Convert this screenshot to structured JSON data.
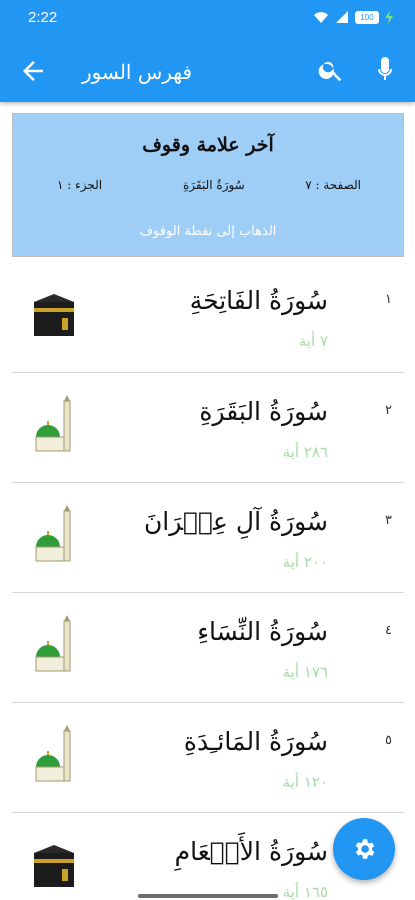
{
  "status_bar": {
    "time": "2:22",
    "battery": "100"
  },
  "header": {
    "title": "فهرس السور"
  },
  "bookmark": {
    "title": "آخر علامة وقوف",
    "page_label": "الصفحة : ٧",
    "sura_label": "سُورَةُ البَقَرَةِ",
    "juz_label": "الجزء : ١",
    "goto_label": "الذهاب إلى نقطة الوقوف"
  },
  "suras": [
    {
      "number": "١",
      "name": "سُورَةُ الفَاتِحَةِ",
      "ayat": "٧ أية",
      "place": "kaaba-icon"
    },
    {
      "number": "٢",
      "name": "سُورَةُ البَقَرَةِ",
      "ayat": "٢٨٦ أية",
      "place": "mosque-icon"
    },
    {
      "number": "٣",
      "name": "سُورَةُ آلِ عِمۡرَانَ",
      "ayat": "٢٠٠ أية",
      "place": "mosque-icon"
    },
    {
      "number": "٤",
      "name": "سُورَةُ النِّسَاءِ",
      "ayat": "١٧٦ أية",
      "place": "mosque-icon"
    },
    {
      "number": "٥",
      "name": "سُورَةُ المَائـِدَةِ",
      "ayat": "١٢٠ أية",
      "place": "mosque-icon"
    },
    {
      "number": "",
      "name": "سُورَةُ الأَنۡعَامِ",
      "ayat": "١٦٥ أية",
      "place": "kaaba-icon"
    }
  ],
  "colors": {
    "primary": "#2196f3",
    "card": "#9ecdf6",
    "ayat": "#a7dca7"
  }
}
